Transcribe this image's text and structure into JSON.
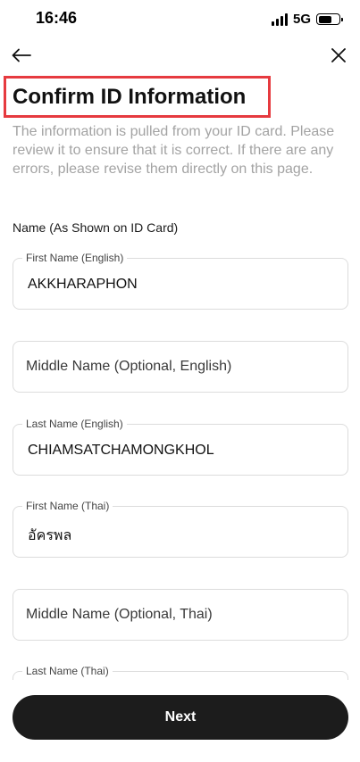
{
  "status_bar": {
    "time": "16:46",
    "network": "5G",
    "icons": [
      "signal-icon",
      "battery-icon"
    ]
  },
  "nav": {
    "back_icon": "arrow-left-icon",
    "close_icon": "close-icon"
  },
  "page": {
    "title": "Confirm ID Information",
    "description": "The information is pulled from your ID card. Please review it to ensure that it is correct. If there are any errors, please revise them directly on this page."
  },
  "section": {
    "label": "Name (As Shown on ID Card)"
  },
  "fields": [
    {
      "label": "First Name (English)",
      "value": "AKKHARAPHON",
      "placeholder": ""
    },
    {
      "label": "",
      "value": "",
      "placeholder": "Middle Name (Optional, English)"
    },
    {
      "label": "Last Name (English)",
      "value": "CHIAMSATCHAMONGKHOL",
      "placeholder": ""
    },
    {
      "label": "First Name (Thai)",
      "value": "อัครพล",
      "placeholder": ""
    },
    {
      "label": "",
      "value": "",
      "placeholder": "Middle Name (Optional, Thai)"
    },
    {
      "label": "Last Name (Thai)",
      "value": "",
      "placeholder": ""
    }
  ],
  "footer": {
    "next_label": "Next"
  },
  "colors": {
    "highlight_border": "#e63a3f",
    "button_bg": "#1c1c1c",
    "description_text": "#a3a3a3"
  }
}
